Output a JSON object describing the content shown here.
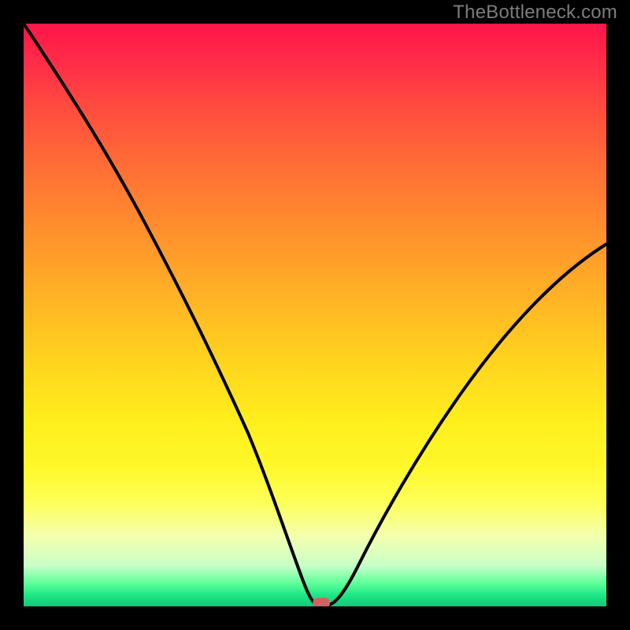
{
  "watermark": "TheBottleneck.com",
  "colors": {
    "frame_bg": "#000000",
    "curve": "#000000",
    "marker": "#d16262",
    "watermark_text": "#7c7c7c"
  },
  "chart_data": {
    "type": "line",
    "title": "",
    "xlabel": "",
    "ylabel": "",
    "xlim": [
      0,
      100
    ],
    "ylim": [
      0,
      100
    ],
    "grid": false,
    "series": [
      {
        "name": "bottleneck-curve",
        "x": [
          0,
          5,
          10,
          15,
          20,
          25,
          30,
          35,
          40,
          45,
          48,
          50,
          52,
          54,
          56,
          60,
          65,
          70,
          75,
          80,
          85,
          90,
          95,
          100
        ],
        "values": [
          100,
          91,
          82,
          73,
          64,
          55,
          46,
          37,
          27,
          15,
          5,
          0,
          0,
          1,
          4,
          10,
          18,
          25,
          32,
          39,
          45,
          51,
          57,
          62
        ]
      }
    ],
    "annotations": [
      {
        "name": "optimal-marker",
        "x": 51,
        "y": 0.5
      }
    ],
    "background_gradient": {
      "top": "#ff1549",
      "mid": "#ffd41e",
      "bottom": "#12c87a",
      "meaning_top": "high-bottleneck",
      "meaning_bottom": "no-bottleneck"
    }
  }
}
